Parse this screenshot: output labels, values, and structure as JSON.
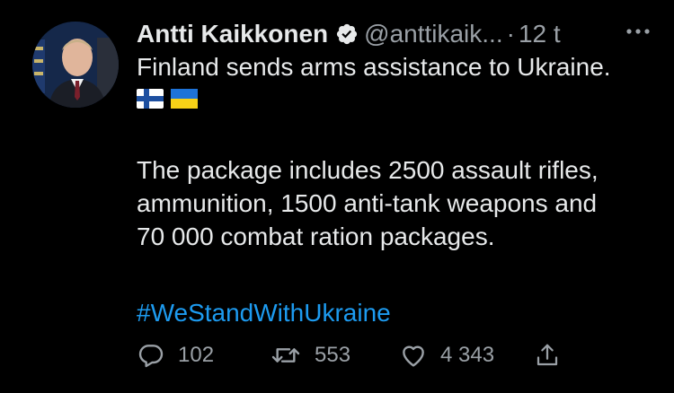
{
  "tweet": {
    "author_name": "Antti Kaikkonen",
    "handle": "@anttikaik...",
    "separator": "·",
    "time": "12 t",
    "lines": [
      "Finland sends arms assistance to Ukraine."
    ],
    "flags": [
      "flag-finland-icon",
      "flag-ukraine-icon"
    ],
    "body_lines": [
      "The package includes 2500 assault rifles,",
      "ammunition, 1500 anti-tank weapons and",
      "70 000 combat ration packages."
    ],
    "hashtag": "#WeStandWithUkraine"
  },
  "actions": {
    "replies": "102",
    "retweets": "553",
    "likes": "4 343"
  },
  "colors": {
    "background": "#000000",
    "text": "#e7e9ea",
    "secondary": "#9aa0a6",
    "link": "#1d9bf0"
  }
}
